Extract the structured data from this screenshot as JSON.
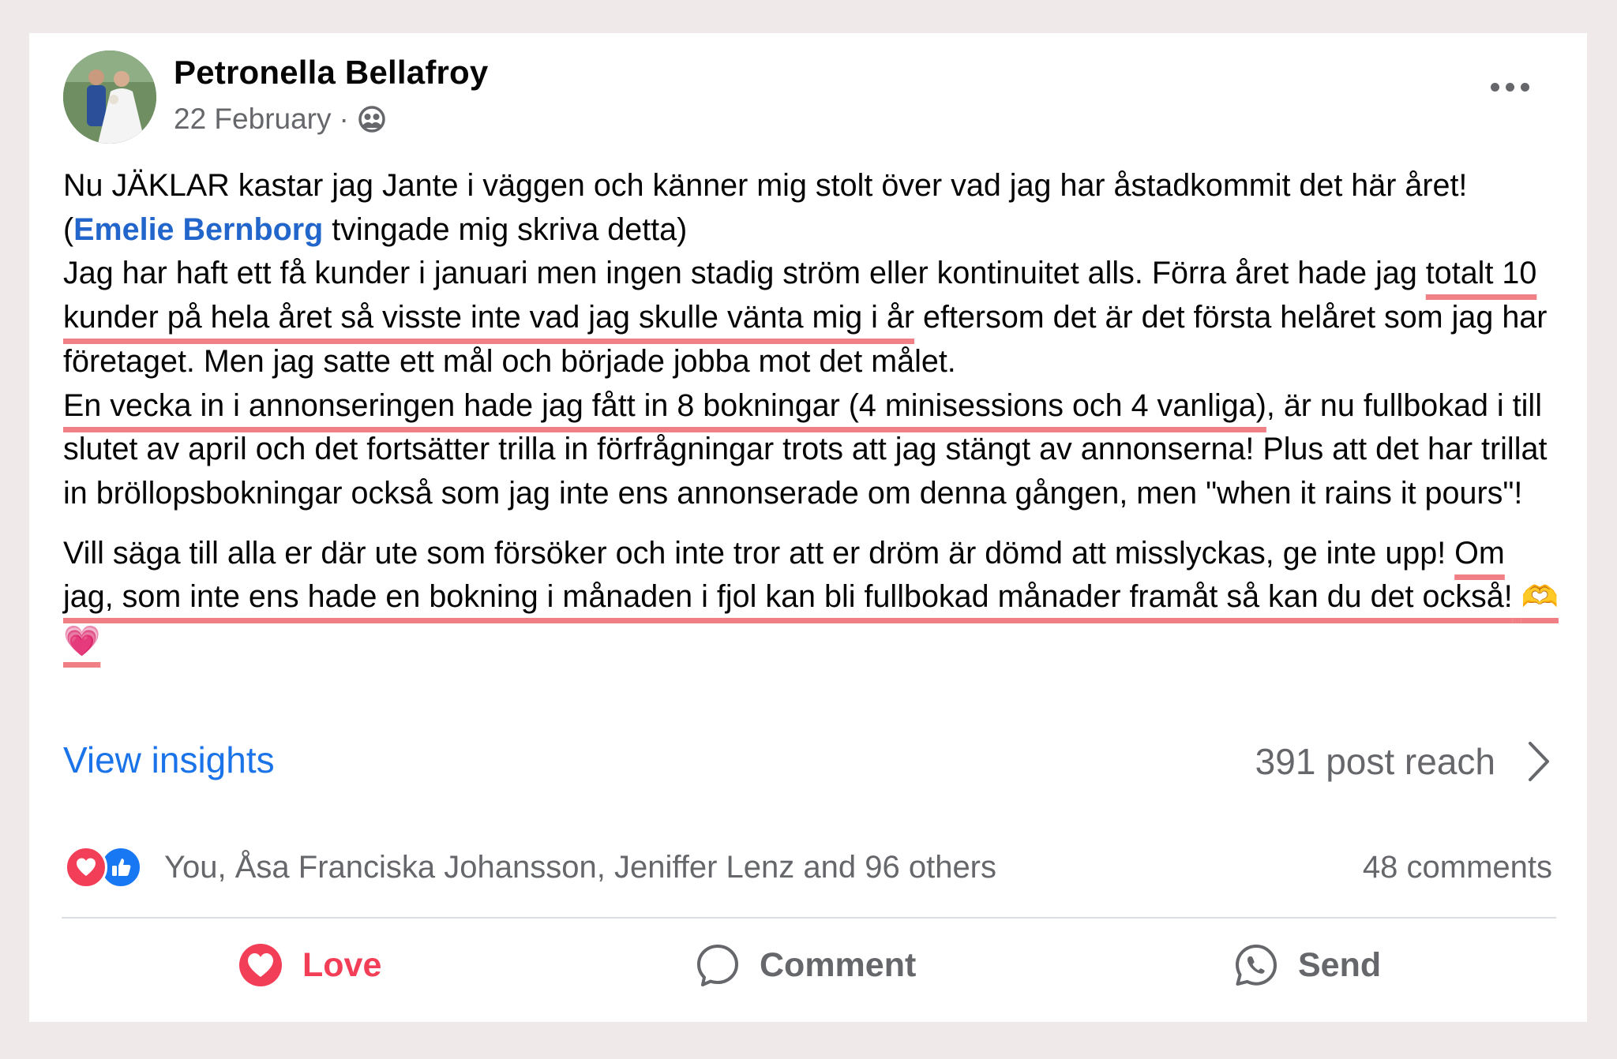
{
  "post": {
    "author": "Petronella Bellafroy",
    "date": "22 February",
    "separator": "·",
    "audience_icon": "friends-icon",
    "p1_a": "Nu JÄKLAR kastar jag Jante i väggen och känner mig stolt över vad jag har åstadkommit det här året! (",
    "mention": "Emelie Bernborg",
    "p1_b": " tvingade mig skriva detta)",
    "p2_a": "Jag har haft ett få kunder i januari men ingen stadig ström eller kontinuitet alls. Förra året hade jag ",
    "p2_ul1": "totalt 10 kunder på hela året så visste inte vad jag skulle vänta mig i år",
    "p2_b": " eftersom det är det första helåret som jag har företaget. Men jag satte ett mål och började jobba mot det målet. ",
    "p2_ul2": "En vecka in i annonseringen hade jag fått in 8 bokningar (4 minisessions och 4 vanliga)",
    "p2_c": ", är nu fullbokad i till slutet av april och det fortsätter trilla in förfrågningar trots att jag stängt av annonserna! Plus att det har trillat in bröllopsbokningar också som jag inte ens annonserade om denna gången, men \"when it rains it pours\"!",
    "p3_a": "Vill säga till alla er där ute som försöker och inte tror att er dröm är dömd att misslyckas, ge inte upp! ",
    "p3_ul": "Om jag, som inte ens hade en bokning i månaden i fjol kan bli fullbokad månader framåt så kan du det också!",
    "emoji_hands": "🫶",
    "emoji_heart": "💗"
  },
  "insights": {
    "label": "View insights",
    "reach": "391 post reach"
  },
  "reactions": {
    "icons": [
      "love-reaction-icon",
      "like-reaction-icon"
    ],
    "names": "You, Åsa Franciska Johansson, Jeniffer Lenz and 96 others",
    "comments": "48 comments"
  },
  "actions": {
    "love": "Love",
    "comment": "Comment",
    "send": "Send"
  },
  "colors": {
    "background": "#efe9e9",
    "link": "#1a73e8",
    "mention": "#2266cc",
    "underline_highlight": "#f17f86",
    "love": "#f33e58",
    "like": "#1877f2",
    "secondary_text": "#65676b"
  }
}
